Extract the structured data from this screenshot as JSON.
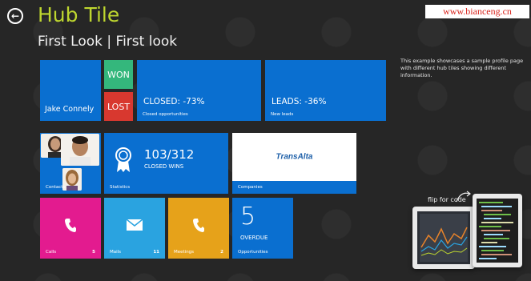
{
  "header": {
    "back_icon": "back-arrow-icon",
    "app_title": "Hub Tile",
    "page_title": "First Look | First look"
  },
  "watermark": "www.bianceng.cn",
  "description": "This example showcases a sample profile page with different hub tiles showing different information.",
  "tiles": {
    "profile": {
      "name": "Jake Connely"
    },
    "won": {
      "label": "WON"
    },
    "lost": {
      "label": "LOST"
    },
    "closed": {
      "value": "CLOSED: -73%",
      "label": "Closed opportunities"
    },
    "leads": {
      "value": "LEADS: -36%",
      "label": "New leads"
    },
    "contacts": {
      "label": "Contacts"
    },
    "statistics": {
      "value": "103/312",
      "caption": "CLOSED WINS",
      "label": "Statistics",
      "icon": "ribbon-award-icon"
    },
    "companies": {
      "logo_text": "TransAlta",
      "label": "Companies"
    },
    "calls": {
      "label": "Calls",
      "count": "5",
      "icon": "phone-icon"
    },
    "mails": {
      "label": "Mails",
      "count": "11",
      "icon": "envelope-icon"
    },
    "meetings": {
      "label": "Meetings",
      "count": "2",
      "icon": "phone-icon"
    },
    "opportunities": {
      "value": "5",
      "caption": "OVERDUE",
      "label": "Opportunities"
    }
  },
  "flip": {
    "label": "flip for code"
  },
  "colors": {
    "background": "#262626",
    "title_accent": "#bed62f",
    "tile_blue": "#0a6fd0",
    "won_green": "#34b77c",
    "lost_red": "#d8382f",
    "calls_pink": "#e31b8f",
    "mails_blue": "#2aa3e0",
    "meetings_orange": "#e6a21a"
  }
}
